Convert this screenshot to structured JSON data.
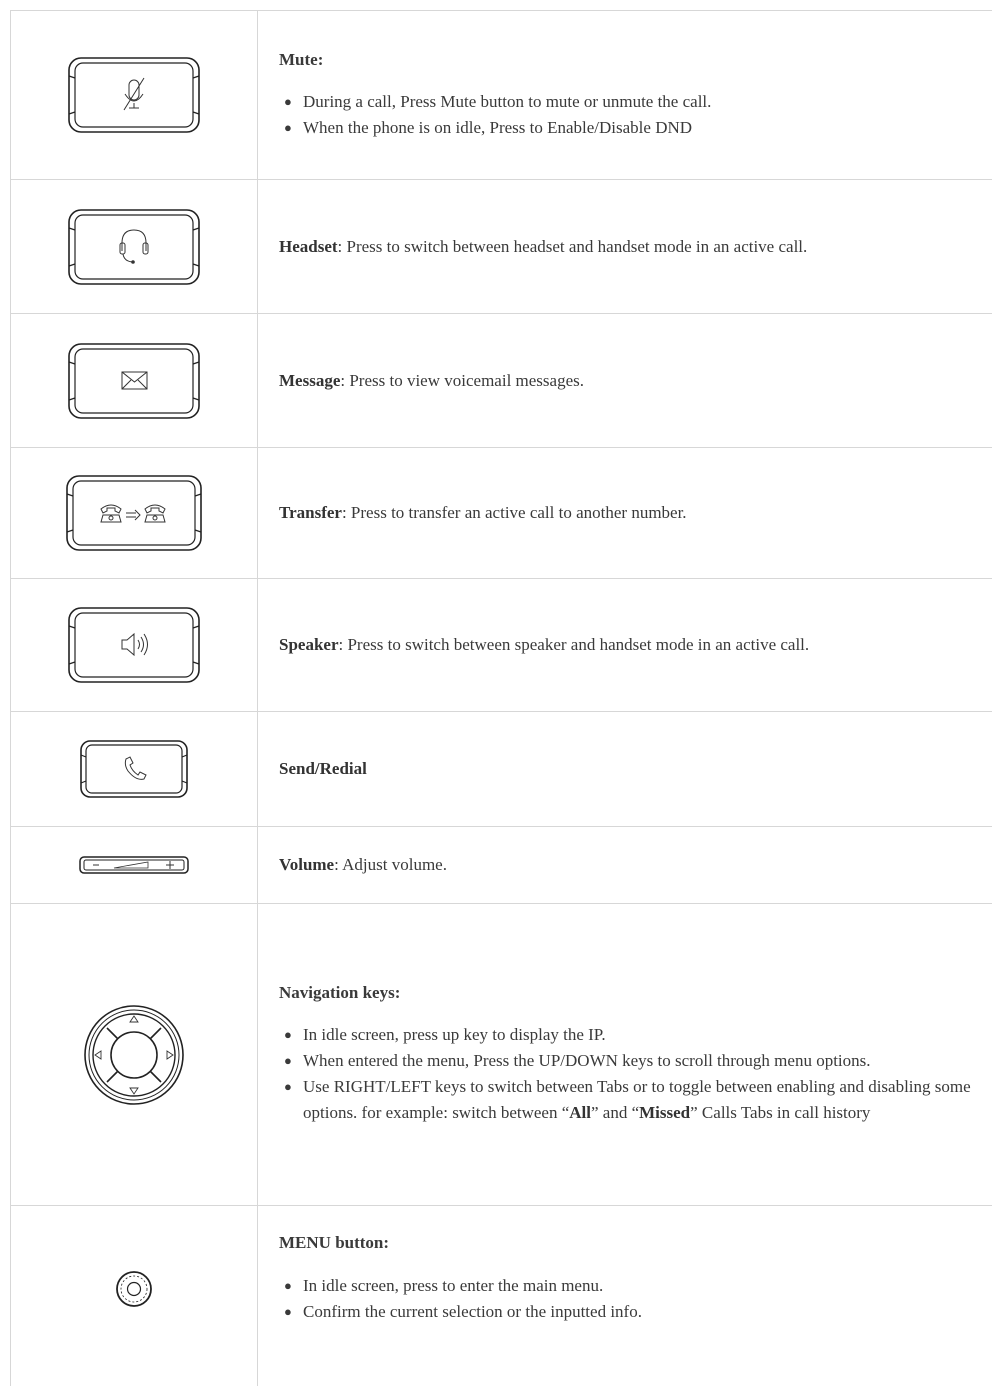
{
  "rows": [
    {
      "id": "mute",
      "icon": "mute-icon",
      "title": "Mute:",
      "bullets": [
        "During a call, Press Mute button to mute or unmute the call.",
        "When the phone is on idle, Press to Enable/Disable DND"
      ]
    },
    {
      "id": "headset",
      "icon": "headset-icon",
      "label": "Headset",
      "desc": ": Press to switch between headset and handset mode in an active call."
    },
    {
      "id": "message",
      "icon": "envelope-icon",
      "label": "Message",
      "desc": ": Press to view voicemail messages."
    },
    {
      "id": "transfer",
      "icon": "transfer-icon",
      "label": "Transfer",
      "desc": ": Press to transfer an active call to another number."
    },
    {
      "id": "speaker",
      "icon": "speaker-icon",
      "label": "Speaker",
      "desc": ": Press to switch between speaker and handset mode in an active call."
    },
    {
      "id": "send",
      "icon": "handset-icon",
      "label": "Send/Redial"
    },
    {
      "id": "volume",
      "icon": "volume-icon",
      "label": "Volume",
      "desc": ": Adjust volume."
    },
    {
      "id": "navigation",
      "icon": "navigation-keys-icon",
      "title": "Navigation keys:",
      "bullets": [
        "In idle screen, press up key to display the IP.",
        "When entered the menu, Press the UP/DOWN keys to scroll through menu options."
      ],
      "b3_part1": "Use RIGHT/LEFT keys to switch between Tabs or to toggle between enabling and disabling some options. for example: switch between “",
      "b3_all": "All",
      "b3_part2": "” and “",
      "b3_missed": "Missed",
      "b3_part3": "” Calls Tabs in call history"
    },
    {
      "id": "menu",
      "icon": "menu-button-icon",
      "title": "MENU button:",
      "bullets": [
        "In idle screen, press to enter the main menu.",
        "Confirm the current selection or the inputted info."
      ]
    }
  ]
}
